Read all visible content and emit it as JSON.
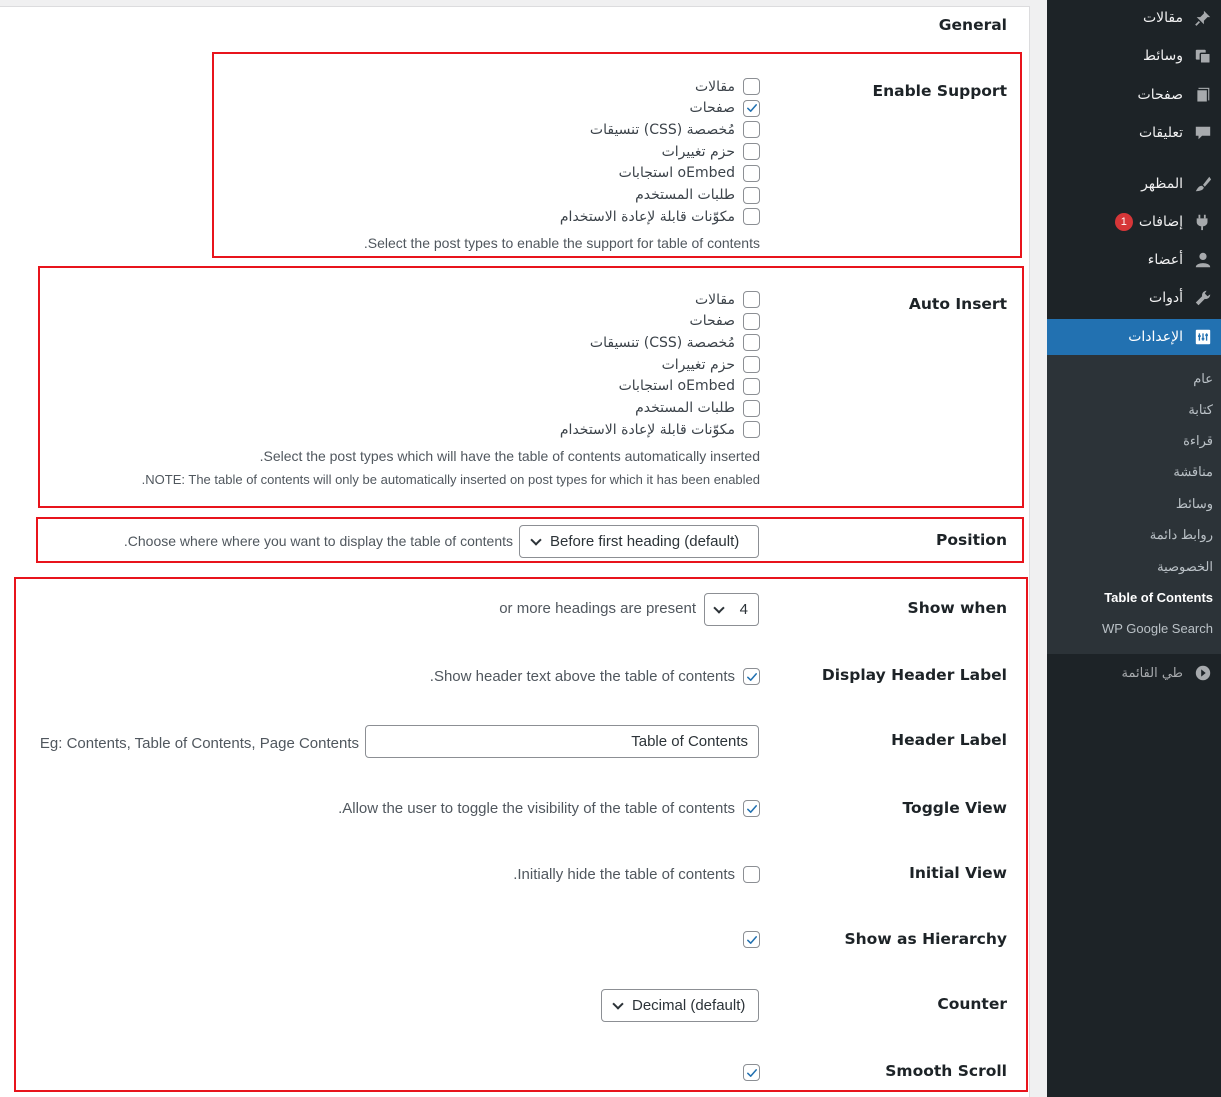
{
  "colors": {
    "sidebar_bg": "#1d2327",
    "submenu_bg": "#2c3338",
    "current_bg": "#2271b1",
    "badge_bg": "#d63638",
    "check_color": "#2271b1",
    "highlight_box": "#e8141c"
  },
  "sidebar": {
    "items": [
      {
        "label": "مقالات",
        "icon": "pushpin-icon"
      },
      {
        "label": "وسائط",
        "icon": "media-icon"
      },
      {
        "label": "صفحات",
        "icon": "pages-icon"
      },
      {
        "label": "تعليقات",
        "icon": "comment-icon"
      },
      {
        "label": "المظهر",
        "icon": "paintbrush-icon"
      },
      {
        "label": "إضافات",
        "icon": "plugin-icon",
        "badge": "1"
      },
      {
        "label": "أعضاء",
        "icon": "users-icon"
      },
      {
        "label": "أدوات",
        "icon": "wrench-icon"
      },
      {
        "label": "الإعدادات",
        "icon": "settings-icon",
        "current": true
      }
    ],
    "submenu": [
      "عام",
      "كتابة",
      "قراءة",
      "مناقشة",
      "وسائط",
      "روابط دائمة",
      "الخصوصية",
      "Table of Contents",
      "WP Google Search"
    ],
    "active_submenu": "Table of Contents",
    "collapse_label": "طي القائمة"
  },
  "settings": {
    "section_title": "General",
    "enable_support": {
      "label": "Enable Support",
      "options": [
        {
          "label": "مقالات",
          "checked": false
        },
        {
          "label": "صفحات",
          "checked": true
        },
        {
          "label": "تنسيقات (CSS) مُخصصة",
          "checked": false
        },
        {
          "label": "حزم تغييرات",
          "checked": false
        },
        {
          "label": "استجابات oEmbed",
          "checked": false
        },
        {
          "label": "طلبات المستخدم",
          "checked": false
        },
        {
          "label": "مكوّنات قابلة لإعادة الاستخدام",
          "checked": false
        }
      ],
      "description": ".Select the post types to enable the support for table of contents"
    },
    "auto_insert": {
      "label": "Auto Insert",
      "options": [
        {
          "label": "مقالات",
          "checked": false
        },
        {
          "label": "صفحات",
          "checked": false
        },
        {
          "label": "تنسيقات (CSS) مُخصصة",
          "checked": false
        },
        {
          "label": "حزم تغييرات",
          "checked": false
        },
        {
          "label": "استجابات oEmbed",
          "checked": false
        },
        {
          "label": "طلبات المستخدم",
          "checked": false
        },
        {
          "label": "مكوّنات قابلة لإعادة الاستخدام",
          "checked": false
        }
      ],
      "description": ".Select the post types which will have the table of contents automatically inserted",
      "note": ".NOTE: The table of contents will only be automatically inserted on post types for which it has been enabled"
    },
    "position": {
      "label": "Position",
      "selected": "Before first heading (default)",
      "description": ".Choose where where you want to display the table of contents"
    },
    "show_when": {
      "label": "Show when",
      "value": "4",
      "suffix": "or more headings are present"
    },
    "display_header_label": {
      "label": "Display Header Label",
      "checked": true,
      "description": ".Show header text above the table of contents"
    },
    "header_label": {
      "label": "Header Label",
      "value": "Table of Contents",
      "hint": "Eg: Contents, Table of Contents, Page Contents"
    },
    "toggle_view": {
      "label": "Toggle View",
      "checked": true,
      "description": ".Allow the user to toggle the visibility of the table of contents"
    },
    "initial_view": {
      "label": "Initial View",
      "checked": false,
      "description": ".Initially hide the table of contents"
    },
    "show_as_hierarchy": {
      "label": "Show as Hierarchy",
      "checked": true
    },
    "counter": {
      "label": "Counter",
      "selected": "Decimal (default)"
    },
    "smooth_scroll": {
      "label": "Smooth Scroll",
      "checked": true
    }
  }
}
